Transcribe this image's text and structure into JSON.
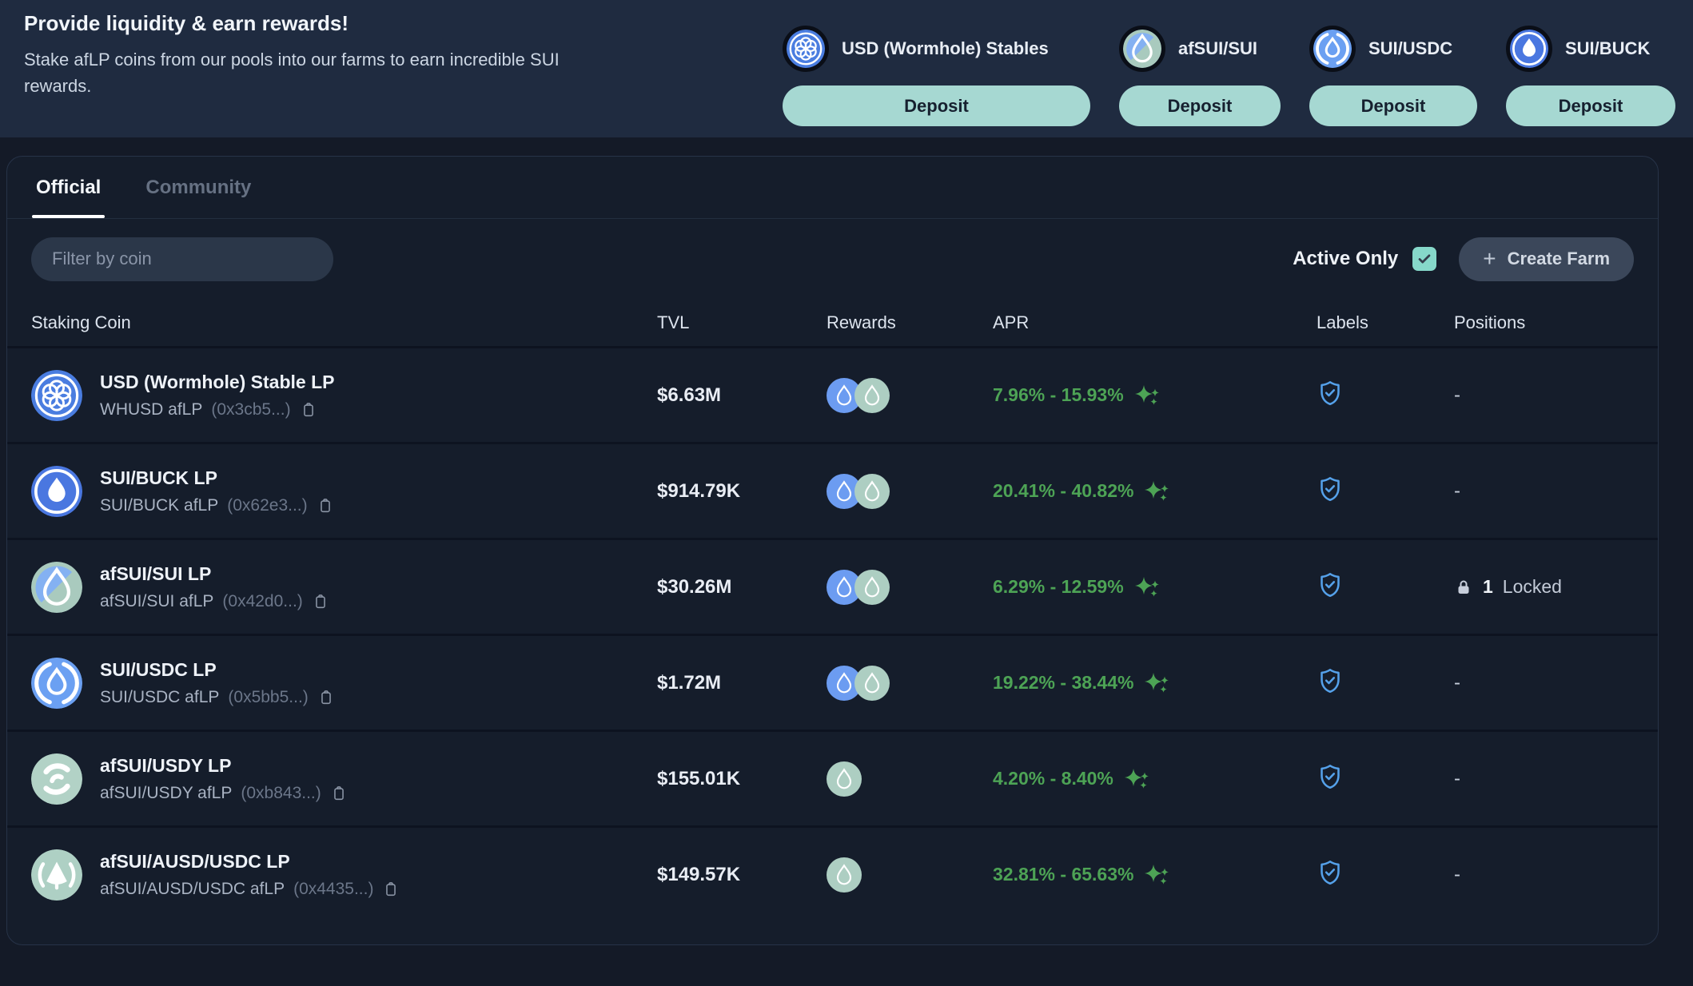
{
  "banner": {
    "title": "Provide liquidity & earn rewards!",
    "subtitle": "Stake afLP coins from our pools into our farms to earn incredible SUI rewards.",
    "cards": [
      {
        "name": "USD (Wormhole) Stables",
        "icon": "wormhole-coin-icon",
        "button": "Deposit"
      },
      {
        "name": "afSUI/SUI",
        "icon": "afsui-sui-coin-icon",
        "button": "Deposit"
      },
      {
        "name": "SUI/USDC",
        "icon": "sui-usdc-coin-icon",
        "button": "Deposit"
      },
      {
        "name": "SUI/BUCK",
        "icon": "sui-buck-coin-icon",
        "button": "Deposit"
      }
    ]
  },
  "tabs": [
    {
      "label": "Official",
      "active": true
    },
    {
      "label": "Community",
      "active": false
    }
  ],
  "filter": {
    "placeholder": "Filter by coin"
  },
  "active_only": {
    "label": "Active Only",
    "checked": true
  },
  "create_farm": {
    "label": "Create Farm",
    "plus": "+"
  },
  "table": {
    "columns": [
      "Staking Coin",
      "TVL",
      "Rewards",
      "APR",
      "Labels",
      "Positions"
    ],
    "rows": [
      {
        "name": "USD (Wormhole) Stable LP",
        "symbol": "WHUSD afLP",
        "address": "(0x3cb5...)",
        "tvl": "$6.63M",
        "icon": "wormhole-coin-icon",
        "rewards": [
          "sui-reward-icon",
          "afsui-reward-icon"
        ],
        "apr": "7.96% - 15.93%",
        "label": "verified-shield",
        "positions": "-"
      },
      {
        "name": "SUI/BUCK LP",
        "symbol": "SUI/BUCK afLP",
        "address": "(0x62e3...)",
        "tvl": "$914.79K",
        "icon": "sui-buck-coin-icon",
        "rewards": [
          "sui-reward-icon",
          "afsui-reward-icon"
        ],
        "apr": "20.41% - 40.82%",
        "label": "verified-shield",
        "positions": "-"
      },
      {
        "name": "afSUI/SUI LP",
        "symbol": "afSUI/SUI afLP",
        "address": "(0x42d0...)",
        "tvl": "$30.26M",
        "icon": "afsui-sui-coin-icon",
        "rewards": [
          "sui-reward-icon",
          "afsui-reward-icon"
        ],
        "apr": "6.29% - 12.59%",
        "label": "verified-shield",
        "positions": "1 Locked",
        "locked_count": "1",
        "locked_label": "Locked"
      },
      {
        "name": "SUI/USDC LP",
        "symbol": "SUI/USDC afLP",
        "address": "(0x5bb5...)",
        "tvl": "$1.72M",
        "icon": "sui-usdc-coin-icon",
        "rewards": [
          "sui-reward-icon",
          "afsui-reward-icon"
        ],
        "apr": "19.22% - 38.44%",
        "label": "verified-shield",
        "positions": "-"
      },
      {
        "name": "afSUI/USDY LP",
        "symbol": "afSUI/USDY afLP",
        "address": "(0xb843...)",
        "tvl": "$155.01K",
        "icon": "afsui-usdy-coin-icon",
        "rewards": [
          "afsui-reward-icon"
        ],
        "apr": "4.20% - 8.40%",
        "label": "verified-shield",
        "positions": "-"
      },
      {
        "name": "afSUI/AUSD/USDC LP",
        "symbol": "afSUI/AUSD/USDC afLP",
        "address": "(0x4435...)",
        "tvl": "$149.57K",
        "icon": "afsui-ausd-usdc-coin-icon",
        "rewards": [
          "afsui-reward-icon"
        ],
        "apr": "32.81% - 65.63%",
        "label": "verified-shield",
        "positions": "-"
      }
    ]
  },
  "colors": {
    "accent_teal": "#a6d8d2",
    "apr_green": "#4da355",
    "verified_blue": "#55a1ea",
    "checkbox_teal": "#86d8ca",
    "sui_blue": "#6c9cf1",
    "afsui_sage": "#adcec2"
  }
}
